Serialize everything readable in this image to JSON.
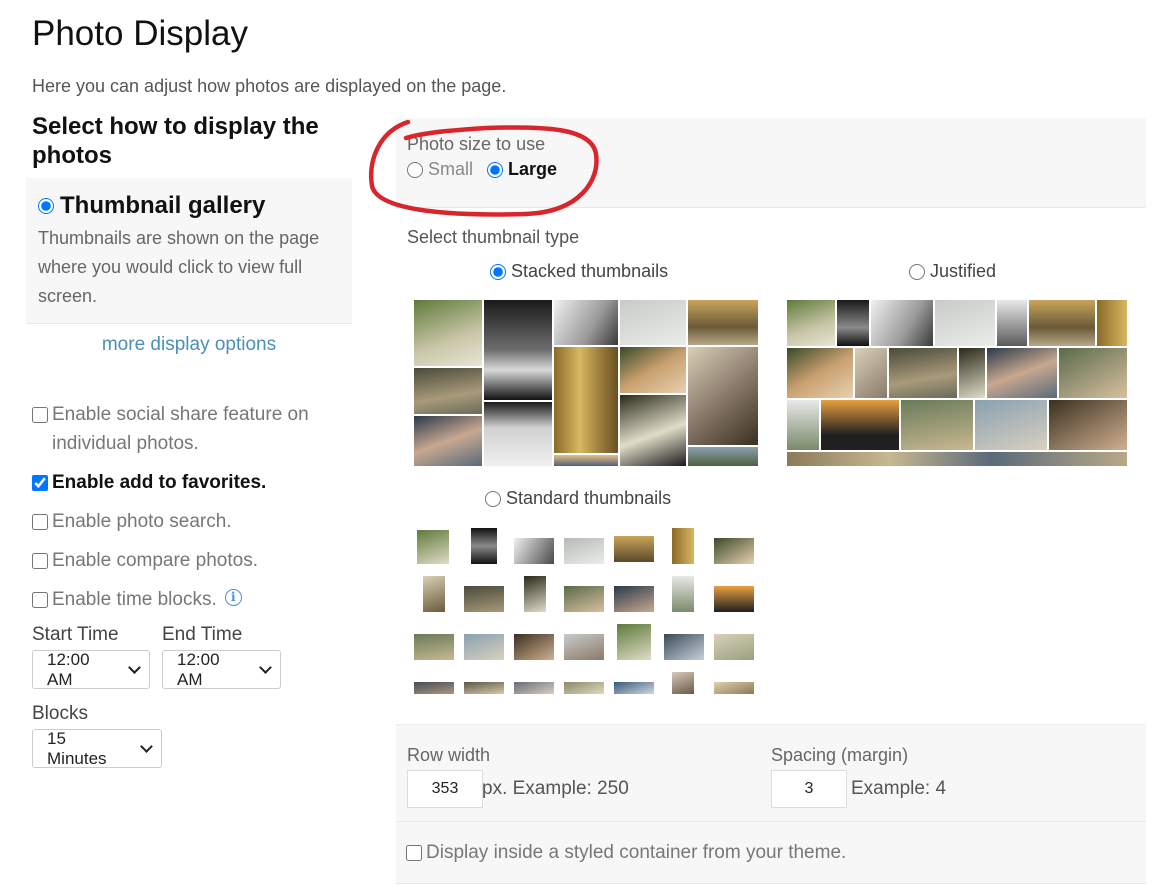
{
  "page": {
    "title": "Photo Display",
    "description": "Here you can adjust how photos are displayed on the page."
  },
  "display": {
    "heading": "Select how to display the photos",
    "option_label": "Thumbnail gallery",
    "option_desc": "Thumbnails are shown on the page where you would click to view full screen.",
    "more_link": "more display options"
  },
  "features": [
    {
      "label": "Enable social share feature on individual photos.",
      "checked": false
    },
    {
      "label": "Enable add to favorites.",
      "checked": true
    },
    {
      "label": "Enable photo search.",
      "checked": false
    },
    {
      "label": "Enable compare photos.",
      "checked": false
    },
    {
      "label": "Enable time blocks.",
      "checked": false
    }
  ],
  "time": {
    "start_label": "Start Time",
    "start_value": "12:00 AM",
    "end_label": "End Time",
    "end_value": "12:00 AM",
    "blocks_label": "Blocks",
    "blocks_value": "15 Minutes"
  },
  "photo_size": {
    "label": "Photo size to use",
    "options": [
      {
        "label": "Small",
        "selected": false
      },
      {
        "label": "Large",
        "selected": true
      }
    ]
  },
  "thumbnail_type": {
    "label": "Select thumbnail type",
    "options": [
      {
        "label": "Stacked thumbnails",
        "selected": true
      },
      {
        "label": "Justified",
        "selected": false
      },
      {
        "label": "Standard thumbnails",
        "selected": false
      }
    ]
  },
  "row_width": {
    "label": "Row width",
    "value": "353",
    "hint": "px. Example: 250"
  },
  "spacing": {
    "label": "Spacing (margin)",
    "value": "3",
    "hint": "Example: 4"
  },
  "container": {
    "label": "Display inside a styled container from your theme.",
    "checked": false
  },
  "colors": {
    "accent": "#4a90d8",
    "link": "#4a90b8",
    "annotation": "#d8262c",
    "panel_bg": "#f7f7f7"
  }
}
